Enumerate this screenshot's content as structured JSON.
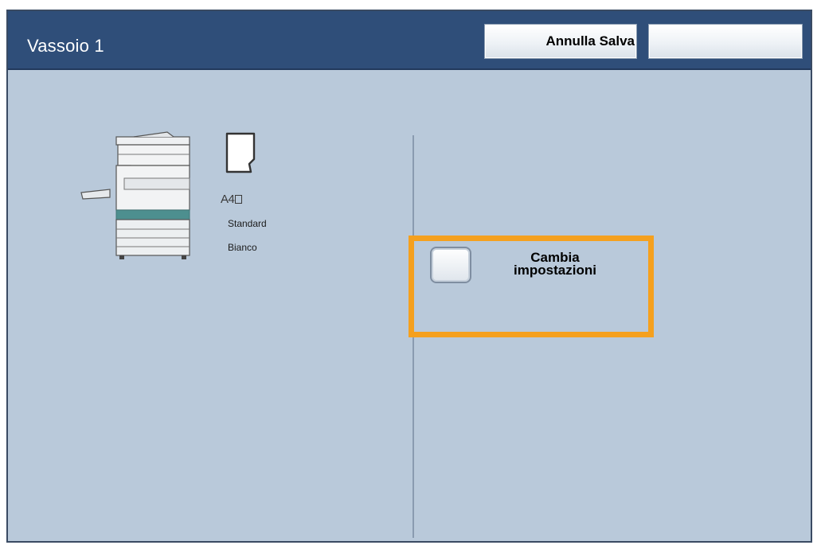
{
  "header": {
    "title": "Vassoio 1",
    "cancel_save_label": "Annulla Salva",
    "blank_button_label": ""
  },
  "tray": {
    "paper_size": "A4",
    "paper_type": "Standard",
    "paper_color": "Bianco"
  },
  "actions": {
    "change_settings_label_line1": "Cambia",
    "change_settings_label_line2": "impostazioni"
  },
  "colors": {
    "header_bg": "#2f4e79",
    "panel_bg": "#b9c9da",
    "highlight": "#f5a01e"
  }
}
